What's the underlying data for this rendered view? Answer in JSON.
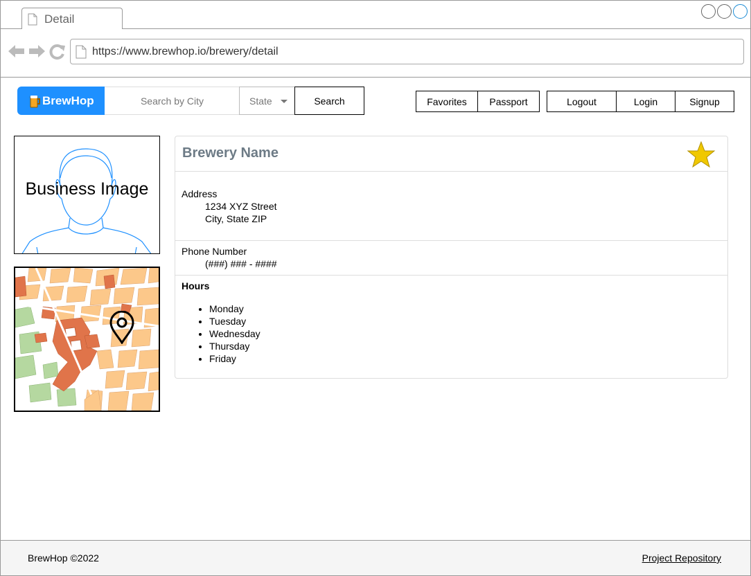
{
  "browser": {
    "tab_title": "Detail",
    "url": "https://www.brewhop.io/brewery/detail"
  },
  "header": {
    "logo_text": "BrewHop",
    "search_placeholder": "Search by City",
    "state_label": "State",
    "search_button": "Search",
    "nav_left": [
      "Favorites",
      "Passport"
    ],
    "nav_right": [
      "Logout",
      "Login",
      "Signup"
    ]
  },
  "left": {
    "image_label": "Business Image"
  },
  "detail": {
    "name": "Brewery Name",
    "address_label": "Address",
    "address_line1": "1234 XYZ Street",
    "address_line2": "City, State ZIP",
    "phone_label": "Phone Number",
    "phone_value": "(###) ### - ####",
    "hours_label": "Hours",
    "hours": [
      "Monday",
      "Tuesday",
      "Wednesday",
      "Thursday",
      "Friday"
    ]
  },
  "footer": {
    "copyright": "BrewHop ©2022",
    "repo_link": "Project Repository"
  },
  "colors": {
    "brand_blue": "#1e90ff",
    "title_gray": "#6d7b86",
    "star_gold": "#f0c800"
  }
}
